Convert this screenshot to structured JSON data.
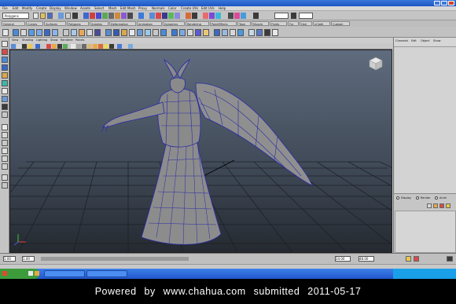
{
  "window": {
    "title": ""
  },
  "menubar": {
    "items": [
      "File",
      "Edit",
      "Modify",
      "Create",
      "Display",
      "Window",
      "Assets",
      "Select",
      "Mesh",
      "Edit Mesh",
      "Proxy",
      "Normals",
      "Color",
      "Create UVs",
      "Edit UVs",
      "Help"
    ]
  },
  "status_line": {
    "mode_select": "Polygons",
    "field_1": "",
    "field_2": ""
  },
  "shelf": {
    "tabs": [
      "General",
      "Curves",
      "Surfaces",
      "Polygons",
      "Subdivs",
      "Deformation",
      "Animation",
      "Dynamics",
      "Rendering",
      "PaintEffects",
      "Toon",
      "Muscle",
      "Fluids",
      "Fur",
      "Hair",
      "nCloth",
      "Custom"
    ]
  },
  "panel_menu": {
    "items": [
      "View",
      "Shading",
      "Lighting",
      "Show",
      "Renderer",
      "Panels"
    ]
  },
  "channel_box": {
    "header_items": [
      "Channels",
      "Edit",
      "Object",
      "Show"
    ]
  },
  "layer_editor": {
    "options": [
      "Display",
      "Render",
      "Anim"
    ]
  },
  "timeline": {
    "start": "1.00",
    "current": "1.00",
    "end": "24.00",
    "range_end": "48.00"
  },
  "taskbar": {
    "start_label": "",
    "tasks": [
      "",
      ""
    ],
    "clock": ""
  },
  "credit": {
    "text": "Powered by www.chahua.com submitted 2011-05-17"
  },
  "colors": {
    "title_blue": "#1d55c4",
    "viewport_top": "#5f6c7e",
    "viewport_bottom": "#252a31",
    "wire_blue": "#2a2aa8",
    "model_gray": "#8f8f8f"
  }
}
